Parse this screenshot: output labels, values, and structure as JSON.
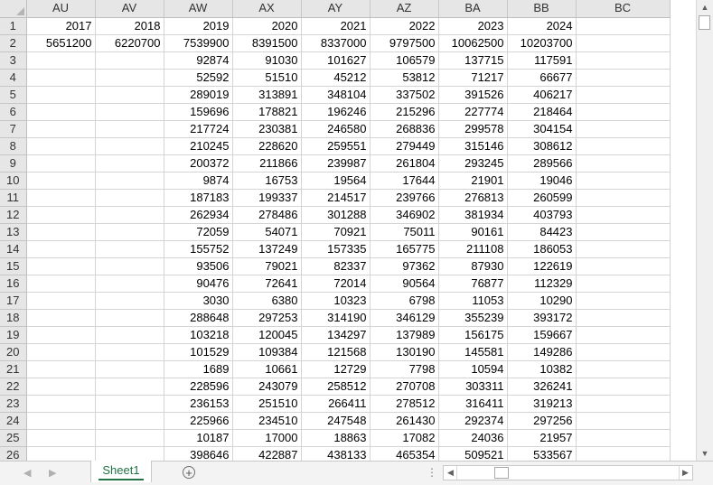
{
  "grid": {
    "columns": [
      "AU",
      "AV",
      "AW",
      "AX",
      "AY",
      "AZ",
      "BA",
      "BB",
      "BC"
    ],
    "row_numbers": [
      1,
      2,
      3,
      4,
      5,
      6,
      7,
      8,
      9,
      10,
      11,
      12,
      13,
      14,
      15,
      16,
      17,
      18,
      19,
      20,
      21,
      22,
      23,
      24,
      25,
      26
    ],
    "rows": [
      [
        "2017",
        "2018",
        "2019",
        "2020",
        "2021",
        "2022",
        "2023",
        "2024",
        ""
      ],
      [
        "5651200",
        "6220700",
        "7539900",
        "8391500",
        "8337000",
        "9797500",
        "10062500",
        "10203700",
        ""
      ],
      [
        "",
        "",
        "92874",
        "91030",
        "101627",
        "106579",
        "137715",
        "117591",
        ""
      ],
      [
        "",
        "",
        "52592",
        "51510",
        "45212",
        "53812",
        "71217",
        "66677",
        ""
      ],
      [
        "",
        "",
        "289019",
        "313891",
        "348104",
        "337502",
        "391526",
        "406217",
        ""
      ],
      [
        "",
        "",
        "159696",
        "178821",
        "196246",
        "215296",
        "227774",
        "218464",
        ""
      ],
      [
        "",
        "",
        "217724",
        "230381",
        "246580",
        "268836",
        "299578",
        "304154",
        ""
      ],
      [
        "",
        "",
        "210245",
        "228620",
        "259551",
        "279449",
        "315146",
        "308612",
        ""
      ],
      [
        "",
        "",
        "200372",
        "211866",
        "239987",
        "261804",
        "293245",
        "289566",
        ""
      ],
      [
        "",
        "",
        "9874",
        "16753",
        "19564",
        "17644",
        "21901",
        "19046",
        ""
      ],
      [
        "",
        "",
        "187183",
        "199337",
        "214517",
        "239766",
        "276813",
        "260599",
        ""
      ],
      [
        "",
        "",
        "262934",
        "278486",
        "301288",
        "346902",
        "381934",
        "403793",
        ""
      ],
      [
        "",
        "",
        "72059",
        "54071",
        "70921",
        "75011",
        "90161",
        "84423",
        ""
      ],
      [
        "",
        "",
        "155752",
        "137249",
        "157335",
        "165775",
        "211108",
        "186053",
        ""
      ],
      [
        "",
        "",
        "93506",
        "79021",
        "82337",
        "97362",
        "87930",
        "122619",
        ""
      ],
      [
        "",
        "",
        "90476",
        "72641",
        "72014",
        "90564",
        "76877",
        "112329",
        ""
      ],
      [
        "",
        "",
        "3030",
        "6380",
        "10323",
        "6798",
        "11053",
        "10290",
        ""
      ],
      [
        "",
        "",
        "288648",
        "297253",
        "314190",
        "346129",
        "355239",
        "393172",
        ""
      ],
      [
        "",
        "",
        "103218",
        "120045",
        "134297",
        "137989",
        "156175",
        "159667",
        ""
      ],
      [
        "",
        "",
        "101529",
        "109384",
        "121568",
        "130190",
        "145581",
        "149286",
        ""
      ],
      [
        "",
        "",
        "1689",
        "10661",
        "12729",
        "7798",
        "10594",
        "10382",
        ""
      ],
      [
        "",
        "",
        "228596",
        "243079",
        "258512",
        "270708",
        "303311",
        "326241",
        ""
      ],
      [
        "",
        "",
        "236153",
        "251510",
        "266411",
        "278512",
        "316411",
        "319213",
        ""
      ],
      [
        "",
        "",
        "225966",
        "234510",
        "247548",
        "261430",
        "292374",
        "297256",
        ""
      ],
      [
        "",
        "",
        "10187",
        "17000",
        "18863",
        "17082",
        "24036",
        "21957",
        ""
      ],
      [
        "",
        "",
        "398646",
        "422887",
        "438133",
        "465354",
        "509521",
        "533567",
        ""
      ]
    ]
  },
  "sheet_tab": "Sheet1",
  "add_sheet_symbol": "+",
  "split_symbol": "⋮",
  "icons": {
    "scroll_up": "▲",
    "scroll_down": "▼",
    "scroll_left": "◀",
    "scroll_right": "▶",
    "tab_prev": "◀",
    "tab_next": "▶"
  },
  "colors": {
    "accent": "#217346",
    "header_bg": "#e6e6e6",
    "gridline": "#d4d4d4"
  }
}
